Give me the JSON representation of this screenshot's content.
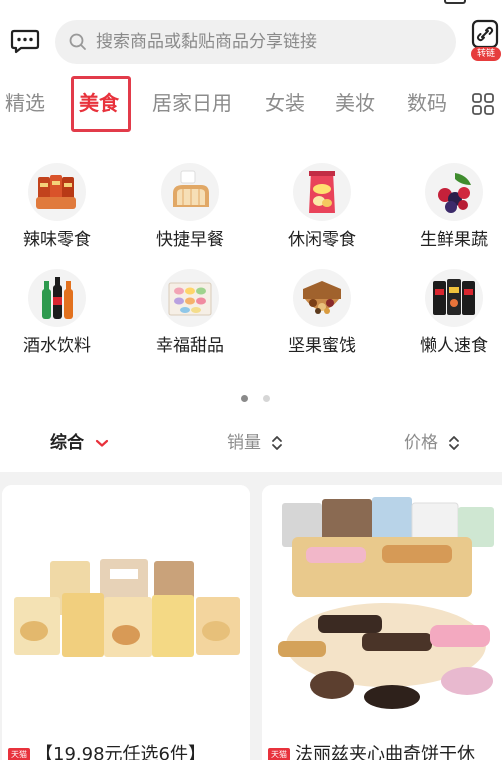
{
  "search": {
    "placeholder": "搜索商品或黏贴商品分享链接"
  },
  "convert": {
    "badge_label": "转链"
  },
  "tabs": [
    {
      "label": "精选",
      "active": false
    },
    {
      "label": "美食",
      "active": true
    },
    {
      "label": "居家日用",
      "active": false
    },
    {
      "label": "女装",
      "active": false
    },
    {
      "label": "美妆",
      "active": false
    },
    {
      "label": "数码",
      "active": false
    }
  ],
  "categories": [
    {
      "label": "辣味零食",
      "icon": "spicy-snack-icon"
    },
    {
      "label": "快捷早餐",
      "icon": "bread-icon"
    },
    {
      "label": "休闲零食",
      "icon": "chips-bag-icon"
    },
    {
      "label": "生鲜果蔬",
      "icon": "berries-icon"
    },
    {
      "label": "酒水饮料",
      "icon": "bottles-icon"
    },
    {
      "label": "幸福甜品",
      "icon": "macaron-icon"
    },
    {
      "label": "坚果蜜饯",
      "icon": "nuts-box-icon"
    },
    {
      "label": "懒人速食",
      "icon": "instant-noodles-icon"
    }
  ],
  "pager": {
    "current_page": 1,
    "total_pages": 2
  },
  "sort": {
    "comprehensive": "综合",
    "sales": "销量",
    "price": "价格"
  },
  "products": [
    {
      "title": "【19.98元任选6件】",
      "badge": "天猫"
    },
    {
      "title": "法丽兹夹心曲奇饼干休",
      "badge": "天猫"
    }
  ],
  "colors": {
    "accent": "#e8323c",
    "tab_box": "#e23b4a",
    "inactive_text": "#8c8c8c"
  }
}
